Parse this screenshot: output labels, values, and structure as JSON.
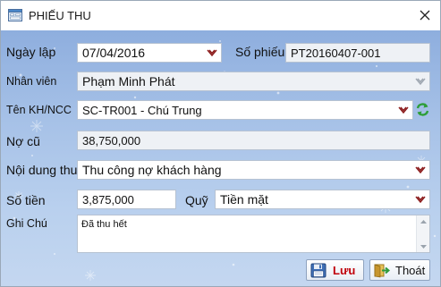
{
  "window": {
    "title": "PHIẾU THU"
  },
  "form": {
    "ngay_lap_label": "Ngày lập",
    "ngay_lap_value": "07/04/2016",
    "so_phieu_label": "Số phiếu",
    "so_phieu_value": "PT20160407-001",
    "nhan_vien_label": "Nhân viên",
    "nhan_vien_value": "Phạm Minh Phát",
    "ten_kh_label": "Tên KH/NCC",
    "ten_kh_value": "SC-TR001 - Chú Trung",
    "no_cu_label": "Nợ cũ",
    "no_cu_value": "38,750,000",
    "noi_dung_label": "Nội dung thu",
    "noi_dung_value": "Thu công nợ khách hàng",
    "so_tien_label": "Số tiền",
    "so_tien_value": "3,875,000",
    "quy_label": "Quỹ",
    "quy_value": "Tiền mặt",
    "ghi_chu_label": "Ghi Chú",
    "ghi_chu_value": "Đã thu hết"
  },
  "buttons": {
    "save_label": "Lưu",
    "exit_label": "Thoát"
  },
  "colors": {
    "background_top": "#8eaede",
    "background_bottom": "#c4d7f0",
    "dropdown_arrow": "#8b1a1a",
    "save_text": "#c0000a",
    "refresh_icon": "#2e9e3a"
  },
  "icons": {
    "title": "form-icon",
    "close": "close-icon",
    "dropdown": "chevron-down-icon",
    "refresh": "refresh-icon",
    "save": "floppy-disk-icon",
    "exit": "exit-door-icon"
  }
}
